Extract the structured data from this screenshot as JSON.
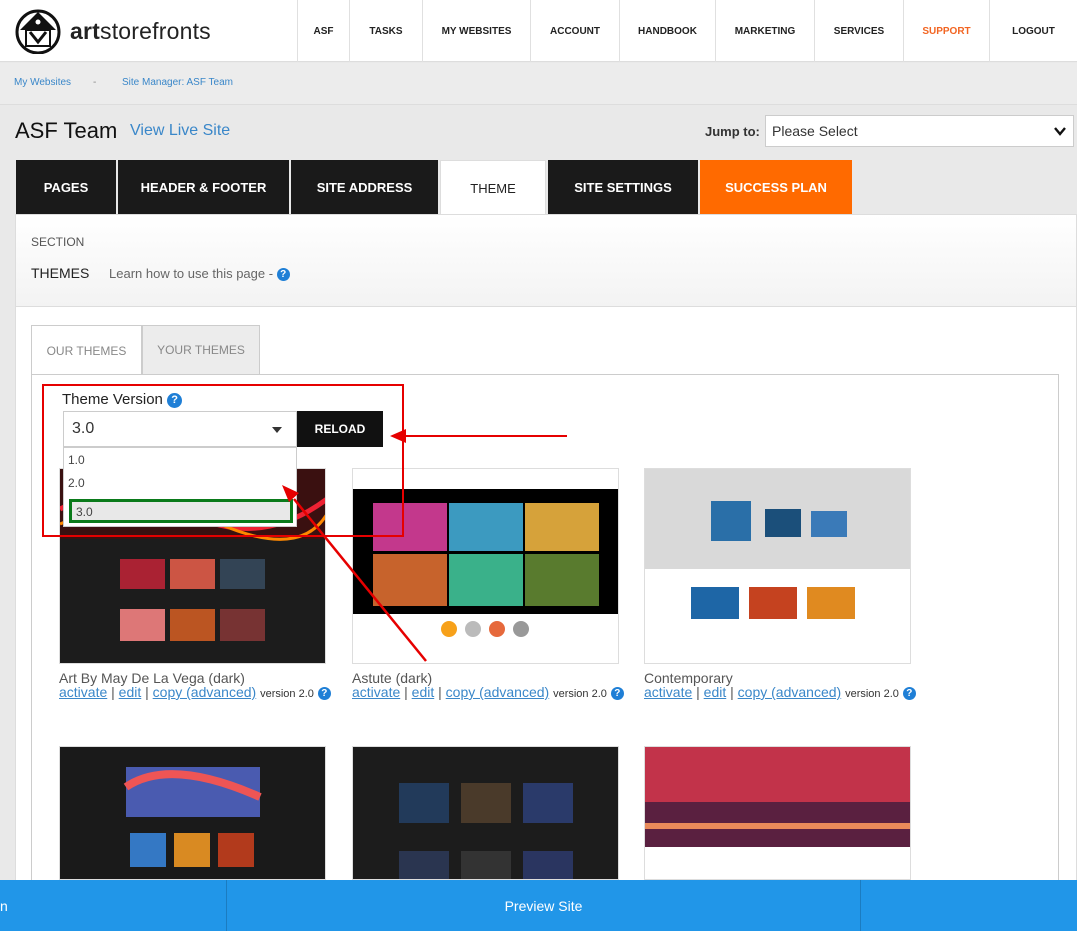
{
  "brand": {
    "logo_text_bold": "art",
    "logo_text_rest": "storefronts"
  },
  "nav": [
    {
      "label": "ASF"
    },
    {
      "label": "TASKS"
    },
    {
      "label": "MY WEBSITES"
    },
    {
      "label": "ACCOUNT"
    },
    {
      "label": "HANDBOOK"
    },
    {
      "label": "MARKETING"
    },
    {
      "label": "SERVICES"
    },
    {
      "label": "SUPPORT"
    },
    {
      "label": "LOGOUT"
    }
  ],
  "breadcrumb": {
    "item1": "My Websites",
    "separator": "-",
    "item2": "Site Manager: ASF Team"
  },
  "site": {
    "title": "ASF Team",
    "view_live": "View Live Site"
  },
  "jump": {
    "label": "Jump to:",
    "value": "Please Select"
  },
  "tabs": [
    {
      "label": "PAGES"
    },
    {
      "label": "HEADER & FOOTER"
    },
    {
      "label": "SITE ADDRESS"
    },
    {
      "label": "THEME"
    },
    {
      "label": "SITE SETTINGS"
    },
    {
      "label": "SUCCESS PLAN"
    }
  ],
  "section": {
    "label": "SECTION",
    "name": "THEMES",
    "learn": "Learn how to use this page -",
    "help": "?"
  },
  "subtabs": [
    {
      "label": "OUR THEMES"
    },
    {
      "label": "YOUR THEMES"
    }
  ],
  "theme_version": {
    "label": "Theme Version",
    "selected": "3.0",
    "options": [
      "1.0",
      "2.0",
      "3.0"
    ],
    "reload": "RELOAD"
  },
  "cards": [
    {
      "name": "Art By May De La Vega (dark)",
      "activate": "activate",
      "edit": "edit",
      "copy": "copy (advanced)",
      "version": "version 2.0"
    },
    {
      "name": "Astute (dark)",
      "activate": "activate",
      "edit": "edit",
      "copy": "copy (advanced)",
      "version": "version 2.0"
    },
    {
      "name": "Contemporary",
      "activate": "activate",
      "edit": "edit",
      "copy": "copy (advanced)",
      "version": "version 2.0"
    }
  ],
  "bottom": {
    "left": "n",
    "center": "Preview Site"
  },
  "colors": {
    "accent_blue": "#2196e8",
    "orange": "#ff6a00",
    "support": "#f26522",
    "link": "#3a87c9",
    "annotation_red": "#e60000",
    "annotation_green": "#0a7a1a"
  }
}
